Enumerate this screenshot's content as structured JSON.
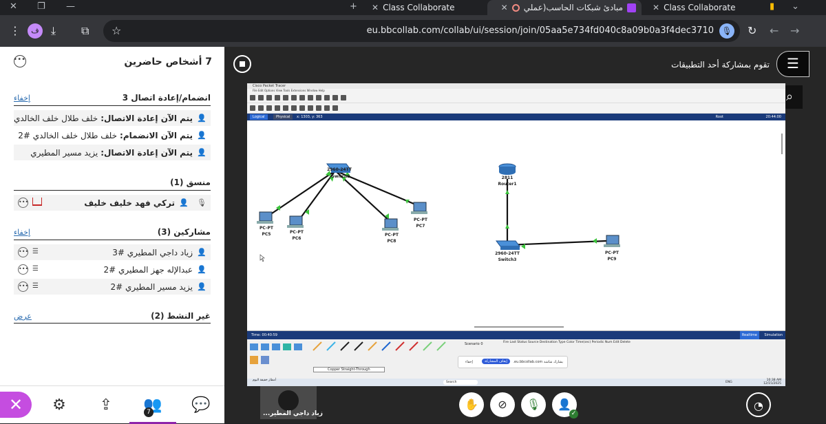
{
  "browser": {
    "tabs": [
      {
        "label": "Class Collaborate"
      },
      {
        "label": "مبادئ شبكات الحاسب(عملي"
      },
      {
        "label": "Class Collaborate"
      }
    ],
    "new_tab": "+",
    "url": "eu.bbcollab.com/collab/ui/session/join/05aa5e734fd040c8a09b0a3f4dec3710",
    "profile_initial": "ف"
  },
  "panel": {
    "title": "7 أشخاص حاضرين",
    "sections": {
      "reconnect": {
        "title": "انضمام/إعادة اتصال 3",
        "action": "إخفاء",
        "items": [
          {
            "status": "يتم الآن إعادة الاتصال:",
            "name": "خلف طلال خلف الخالدي"
          },
          {
            "status": "يتم الآن الانضمام:",
            "name": "خلف طلال خلف الخالدي #2"
          },
          {
            "status": "يتم الآن إعادة الاتصال:",
            "name": "يزيد مسير المطيري"
          }
        ]
      },
      "moderator": {
        "title": "منسق (1)",
        "items": [
          {
            "name": "تركي فهد خليف خليف"
          }
        ]
      },
      "participants": {
        "title": "مشاركين (3)",
        "action": "إخفاء",
        "items": [
          {
            "name": "زياد داجي المطيري #3"
          },
          {
            "name": "عبدالإله جهز المطيري #2"
          },
          {
            "name": "يزيد مسير المطيري #2"
          }
        ]
      },
      "inactive": {
        "title": "غير النشط (2)",
        "action": "عرض"
      }
    },
    "badge_count": "7"
  },
  "stage": {
    "share_label": "تقوم بمشاركة أحد التطبيقات",
    "video_tile_name": "زياد داجي المطير..."
  },
  "packet_tracer": {
    "title": "Cisco Packet Tracer",
    "menu": "File   Edit   Options   View   Tools   Extensions   Window   Help",
    "tab_logical": "Logical",
    "tab_physical": "Physical",
    "coords": "x: 1303, y: 363",
    "root": "Root",
    "clock": "20:44:00",
    "time": "Time: 00:40:59",
    "realtime": "Realtime",
    "simulation": "Simulation",
    "scenario": "Scenario 0",
    "pdu_columns": "Fire   Last Status   Source   Destination   Type   Color   Time(sec)   Periodic   Num   Edit   Delete",
    "cable": "Copper Straight-Through",
    "devices": [
      {
        "id": "sw2",
        "l1": "2960-24TT",
        "l2": "Switch2"
      },
      {
        "id": "pc5",
        "l1": "PC-PT",
        "l2": "PC5"
      },
      {
        "id": "pc6",
        "l1": "PC-PT",
        "l2": "PC6"
      },
      {
        "id": "pc8",
        "l1": "PC-PT",
        "l2": "PC8"
      },
      {
        "id": "pc7",
        "l1": "PC-PT",
        "l2": "PC7"
      },
      {
        "id": "r1",
        "l1": "2811",
        "l2": "Router1"
      },
      {
        "id": "sw3",
        "l1": "2960-24TT",
        "l2": "Switch3"
      },
      {
        "id": "pc9",
        "l1": "PC-PT",
        "l2": "PC9"
      }
    ],
    "share_popup": {
      "message": "يشارك شاشة eu.bbcollab.com.",
      "stop": "إيقاف المشاركة",
      "hide": "إخفاء"
    },
    "taskbar": {
      "weather": "أمطار خفيفة اليوم",
      "search": "Search",
      "lang": "ENG",
      "time": "10:38 AM",
      "date": "12/15/2025"
    }
  },
  "colors": {
    "accent": "#8e24aa",
    "close": "#c54de0",
    "link": "#2b6cb0",
    "mic_on": "#2e7d32",
    "pt_blue": "#1a3a7a"
  }
}
